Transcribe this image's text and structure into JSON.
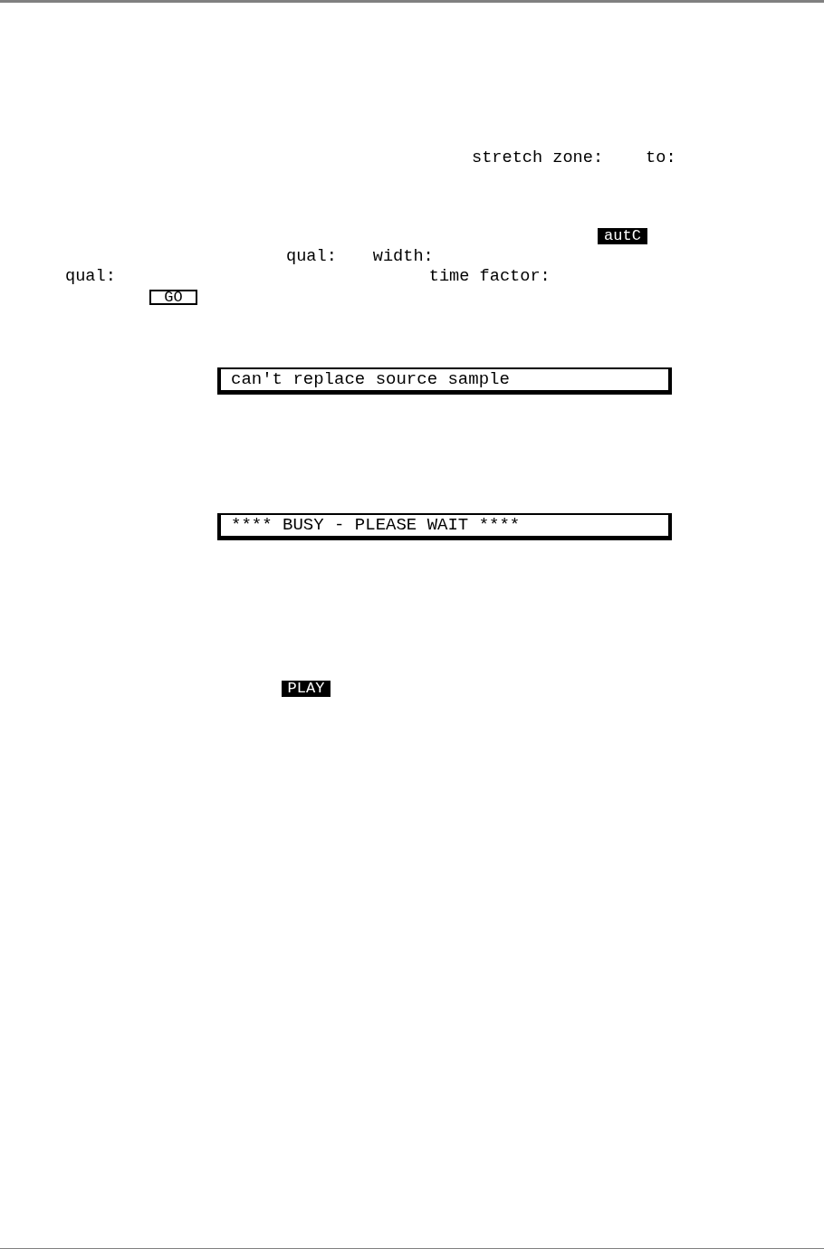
{
  "stretch_zone": {
    "label": "stretch zone:",
    "to_label": "to:"
  },
  "auto_button": {
    "label": "autC",
    "selected": true
  },
  "quality_row": {
    "qual_label": "qual:",
    "width_label": "width:"
  },
  "time_row": {
    "qual_label": "qual:",
    "time_factor_label": "time factor:"
  },
  "go_button": {
    "label": "GO",
    "selected": false
  },
  "messages": [
    "can't replace source sample",
    "**** BUSY - PLEASE WAIT ****"
  ],
  "play_button": {
    "label": "PLAY",
    "selected": true
  }
}
